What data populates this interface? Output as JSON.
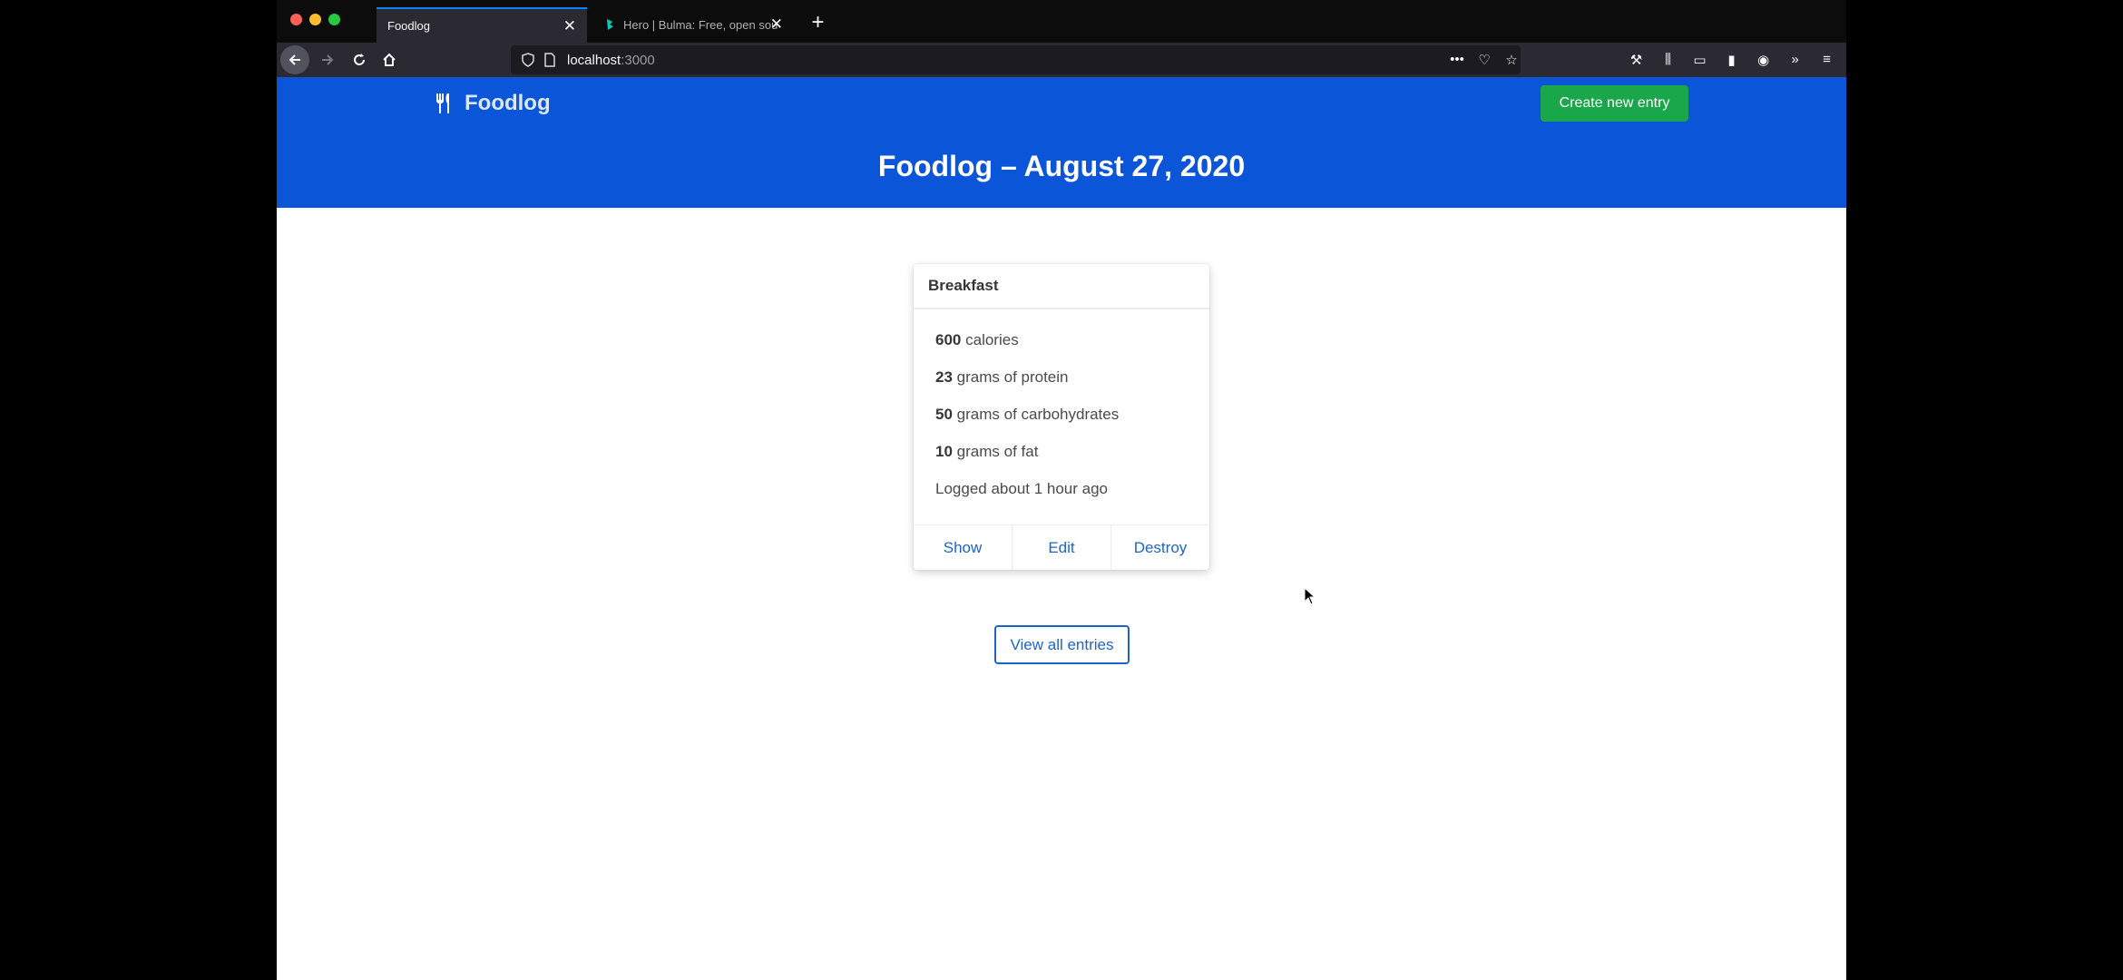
{
  "browser": {
    "tabs": [
      {
        "title": "Foodlog",
        "active": true
      },
      {
        "title": "Hero | Bulma: Free, open source",
        "active": false
      }
    ],
    "url": {
      "host": "localhost",
      "port": ":3000"
    }
  },
  "page": {
    "brand": "Foodlog",
    "create_button": "Create new entry",
    "title": "Foodlog – August 27, 2020",
    "card": {
      "title": "Breakfast",
      "stats": [
        {
          "value": "600",
          "label": "calories"
        },
        {
          "value": "23",
          "label": "grams of protein"
        },
        {
          "value": "50",
          "label": "grams of carbohydrates"
        },
        {
          "value": "10",
          "label": "grams of fat"
        }
      ],
      "logged": "Logged about 1 hour ago",
      "actions": {
        "show": "Show",
        "edit": "Edit",
        "destroy": "Destroy"
      }
    },
    "view_all_button": "View all entries"
  },
  "colors": {
    "hero_bg": "#0b55d9",
    "create_button_bg": "#1aa64a",
    "link": "#1e64c8"
  }
}
